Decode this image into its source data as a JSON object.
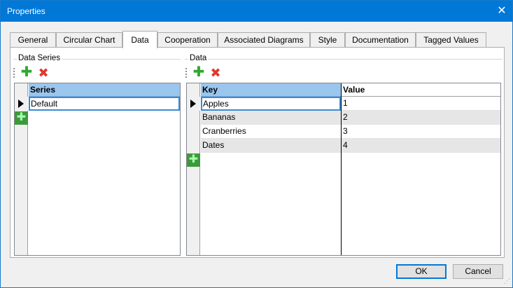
{
  "window": {
    "title": "Properties",
    "close_glyph": "✕"
  },
  "tabs": [
    "General",
    "Circular Chart",
    "Data",
    "Cooperation",
    "Associated Diagrams",
    "Style",
    "Documentation",
    "Tagged Values"
  ],
  "active_tab": "Data",
  "series_group": {
    "title": "Data Series",
    "add_icon": "plus-icon",
    "delete_icon": "delete-icon",
    "column": "Series",
    "rows": [
      "Default"
    ]
  },
  "data_group": {
    "title": "Data",
    "add_icon": "plus-icon",
    "delete_icon": "delete-icon",
    "columns": [
      "Key",
      "Value"
    ],
    "rows": [
      {
        "key": "Apples",
        "value": "1"
      },
      {
        "key": "Bananas",
        "value": "2"
      },
      {
        "key": "Cranberries",
        "value": "3"
      },
      {
        "key": "Dates",
        "value": "4"
      }
    ]
  },
  "buttons": {
    "ok": "OK",
    "cancel": "Cancel"
  },
  "colors": {
    "titlebar": "#0078d7",
    "header_selected": "#9ac6ee",
    "add_green": "#2ea82e",
    "delete_red": "#e0382f"
  }
}
